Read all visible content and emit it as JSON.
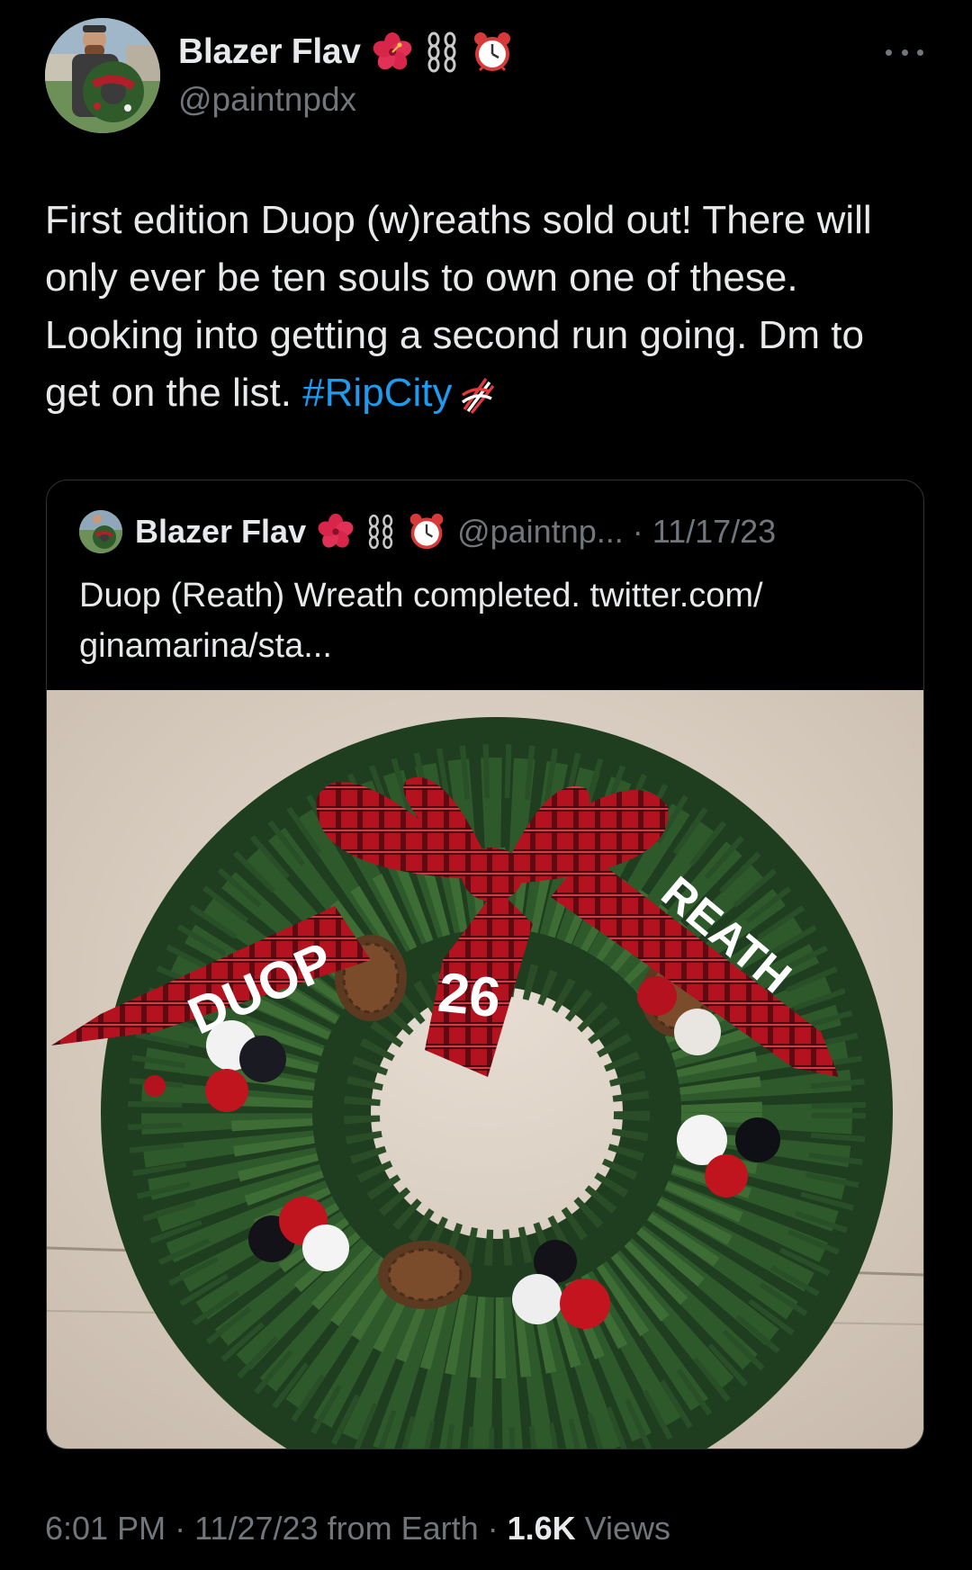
{
  "tweet": {
    "author_name": "Blazer Flav",
    "author_handle": "@paintnpdx",
    "name_emojis": [
      "hibiscus-emoji",
      "chains-emoji",
      "alarm-clock-emoji"
    ],
    "text": "First edition Duop (w)reaths sold out! There will only ever be ten souls to own one of these. Looking into getting a second run going. Dm to get on the list. ",
    "hashtag": "#RipCity",
    "hashtag_icon": "trail-blazers-pinwheel-icon",
    "more_icon": "more-options-icon"
  },
  "quoted_tweet": {
    "author_name": "Blazer Flav",
    "meta": "@paintnp... · 11/17/23",
    "text": "Duop (Reath) Wreath completed. twitter.com/ ginamarina/sta...",
    "image": {
      "ribbon_left_text": "DUOP",
      "ribbon_center_text": "26",
      "ribbon_right_text": "REATH"
    }
  },
  "footer": {
    "time": "6:01 PM",
    "date": "11/27/23",
    "source": "from Earth",
    "views_count": "1.6K",
    "views_label": "Views"
  }
}
